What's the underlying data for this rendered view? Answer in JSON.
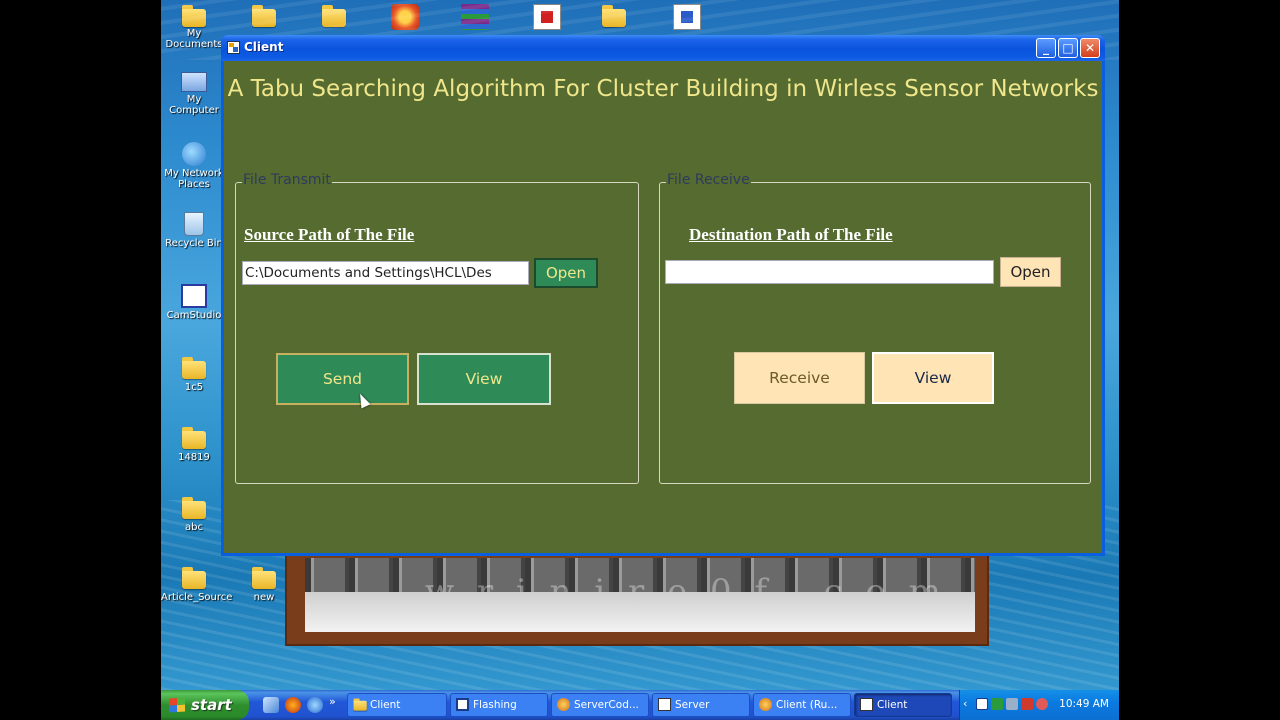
{
  "desktop": {
    "icons": [
      {
        "label": "My Documents",
        "icon": "my-documents-icon"
      },
      {
        "label": "My Computer",
        "icon": "my-computer-icon"
      },
      {
        "label": "My Network Places",
        "icon": "network-places-icon"
      },
      {
        "label": "Recycle Bin",
        "icon": "recycle-bin-icon"
      },
      {
        "label": "CamStudio",
        "icon": "camstudio-icon"
      },
      {
        "label": "1c5",
        "icon": "folder-icon"
      },
      {
        "label": "14819",
        "icon": "folder-icon"
      },
      {
        "label": "abc",
        "icon": "folder-icon"
      },
      {
        "label": "Article_Source",
        "icon": "folder-icon"
      },
      {
        "label": "new",
        "icon": "folder-icon"
      }
    ],
    "wallpaper_watermark": "w  r  i  n  i  r  e  0  f  .  c  o  m"
  },
  "window": {
    "title": "Client",
    "heading": "A Tabu Searching Algorithm For Cluster Building in Wirless Sensor Networks",
    "transmit": {
      "legend": "File Transmit",
      "label": "Source Path of The File",
      "path_value": "C:\\Documents and Settings\\HCL\\Des",
      "open_label": "Open",
      "send_label": "Send",
      "view_label": "View"
    },
    "receive": {
      "legend": "File Receive",
      "label": "Destination Path of The File",
      "path_value": "",
      "open_label": "Open",
      "receive_label": "Receive",
      "view_label": "View"
    }
  },
  "taskbar": {
    "start_label": "start",
    "tasks": [
      {
        "label": "Client",
        "active": false
      },
      {
        "label": "Flashing",
        "active": false
      },
      {
        "label": "ServerCod...",
        "active": false
      },
      {
        "label": "Server",
        "active": false
      },
      {
        "label": "Client (Ru...",
        "active": false
      },
      {
        "label": "Client",
        "active": true
      }
    ],
    "clock": "10:49 AM"
  },
  "colors": {
    "form_background": "#556b2f",
    "heading_text": "#f0e68c",
    "green_button": "#2e8b57",
    "tan_button": "#ffe4b5",
    "xp_titlebar": "#0a54dd"
  }
}
